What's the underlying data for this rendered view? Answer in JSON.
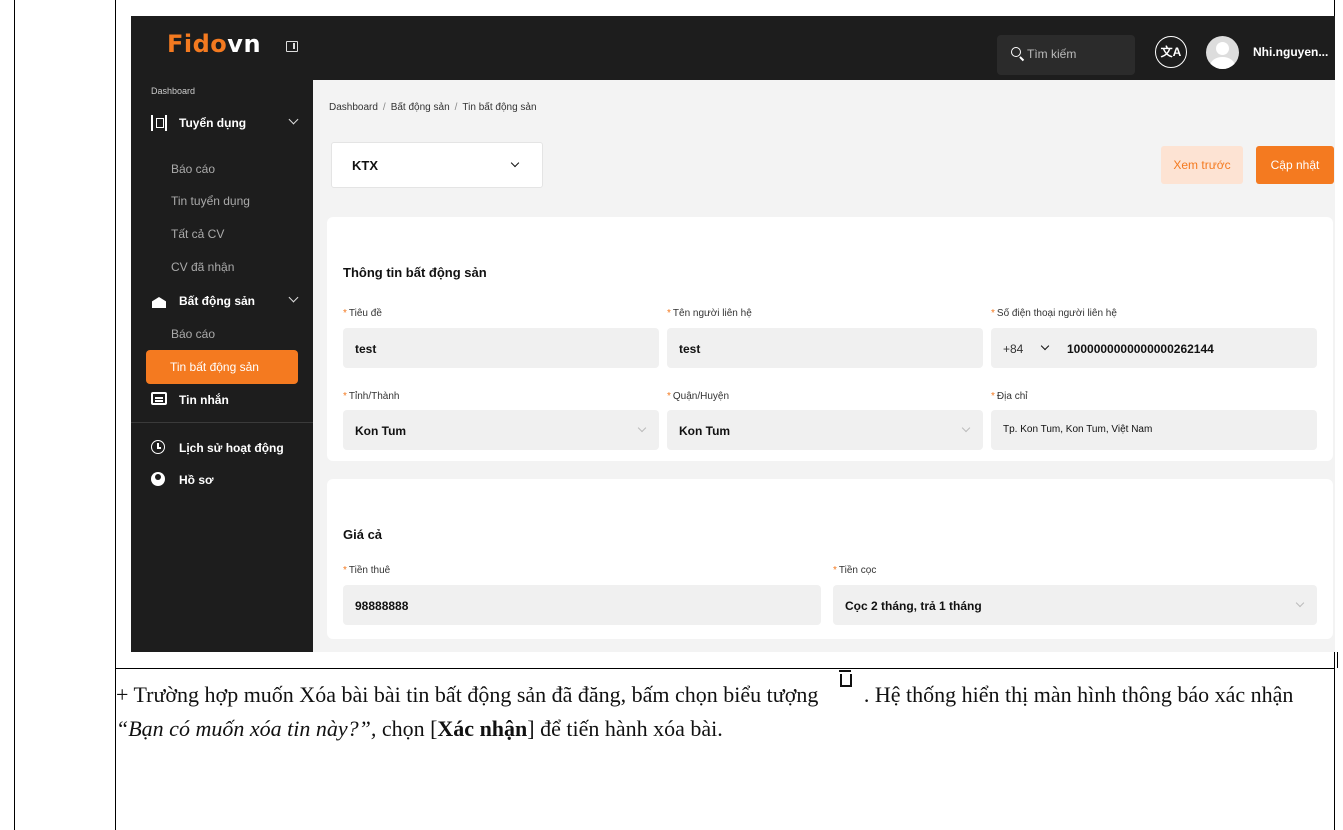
{
  "topbar": {
    "logo_main": "Fido",
    "logo_suffix": "vn",
    "search_placeholder": "Tìm kiếm",
    "lang_glyph": "文A",
    "user_name": "Nhi.nguyen..."
  },
  "sidebar": {
    "section_label": "Dashboard",
    "groups": [
      {
        "label": "Tuyển dụng",
        "icon": "recruitment-icon",
        "items": [
          "Báo cáo",
          "Tin tuyển dụng",
          "Tất cả CV",
          "CV đã nhận"
        ]
      },
      {
        "label": "Bất động sản",
        "icon": "house-icon",
        "items": [
          "Báo cáo",
          "Tin bất động sản"
        ]
      }
    ],
    "active_item": "Tin bất động sản",
    "messages": "Tin nhắn",
    "history": "Lịch sử hoạt động",
    "profile": "Hồ sơ"
  },
  "breadcrumb": [
    "Dashboard",
    "Bất động sản",
    "Tin bất động sản"
  ],
  "type_select": {
    "value": "KTX"
  },
  "actions": {
    "preview": "Xem trước",
    "update": "Cập nhật"
  },
  "property_info": {
    "title": "Thông tin bất động sản",
    "fields": {
      "tieu_de": {
        "label": "Tiêu đề",
        "value": "test"
      },
      "ten_lien_he": {
        "label": "Tên người liên hệ",
        "value": "test"
      },
      "sdt": {
        "label": "Số điện thoại người liên hệ",
        "prefix": "+84",
        "value": "1000000000000000262144"
      },
      "tinh": {
        "label": "Tỉnh/Thành",
        "value": "Kon Tum"
      },
      "quan": {
        "label": "Quận/Huyện",
        "value": "Kon Tum"
      },
      "dia_chi": {
        "label": "Địa chỉ",
        "value": "Tp. Kon Tum, Kon Tum, Việt Nam"
      }
    }
  },
  "price": {
    "title": "Giá cả",
    "fields": {
      "tien_thue": {
        "label": "Tiền thuê",
        "value": "98888888"
      },
      "tien_coc": {
        "label": "Tiền cọc",
        "value": "Cọc 2 tháng, trả 1 tháng"
      }
    }
  },
  "instruction": {
    "part1": "+ Trường hợp muốn Xóa bài bài tin bất động sản đã đăng, bấm chọn biểu tượng",
    "part2": ". Hệ thống hiển thị màn hình thông báo xác nhận ",
    "quote": "“Bạn có muốn xóa tin này?”,",
    "part3": " chọn [",
    "confirm": "Xác nhận",
    "part4": "] để tiến hành xóa bài."
  },
  "colors": {
    "accent": "#f47a20",
    "sidebar_bg": "#1d1d1d",
    "content_bg": "#f3f3f3"
  }
}
